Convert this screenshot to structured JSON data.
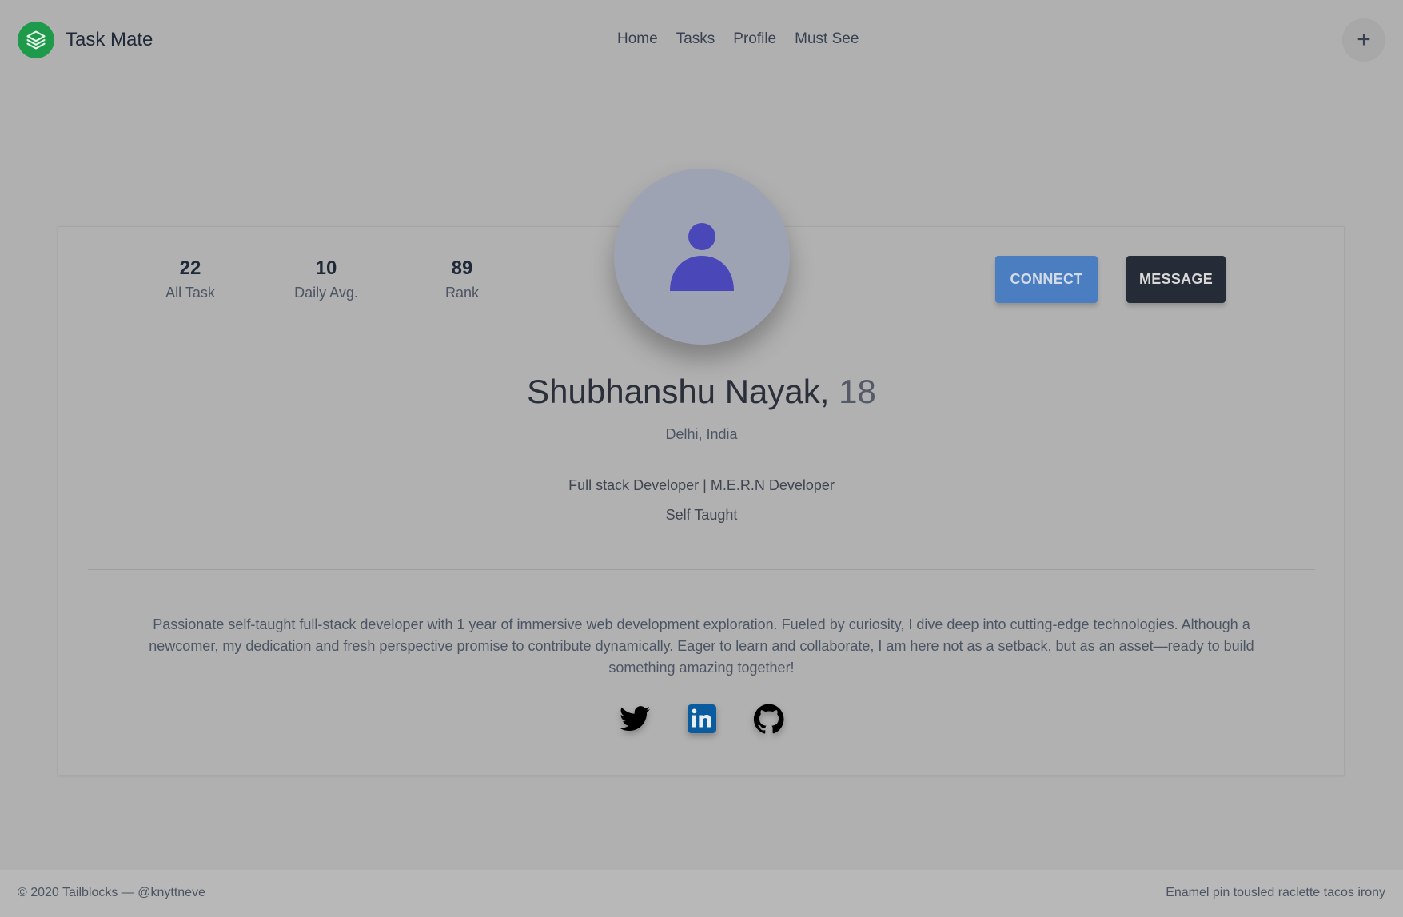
{
  "app": {
    "name": "Task Mate",
    "brand_color": "#1f9a4a"
  },
  "nav": {
    "items": [
      "Home",
      "Tasks",
      "Profile",
      "Must See"
    ]
  },
  "header": {
    "action_icon": "plus-icon",
    "action_symbol": "+"
  },
  "profile": {
    "stats": [
      {
        "value": "22",
        "label": "All Task"
      },
      {
        "value": "10",
        "label": "Daily Avg."
      },
      {
        "value": "89",
        "label": "Rank"
      }
    ],
    "avatar_icon": "user-icon",
    "avatar_color": "#4a47b8",
    "connect_label": "CONNECT",
    "message_label": "MESSAGE",
    "name": "Shubhanshu Nayak,",
    "age": "18",
    "location": "Delhi, India",
    "role": "Full stack Developer | M.E.R.N Developer",
    "tagline": "Self Taught",
    "bio": "Passionate self-taught full-stack developer with 1 year of immersive web development exploration. Fueled by curiosity, I dive deep into cutting-edge technologies. Although a newcomer, my dedication and fresh perspective promise to contribute dynamically. Eager to learn and collaborate, I am here not as a setback, but as an asset—ready to build something amazing together!",
    "socials": [
      "twitter-icon",
      "linkedin-icon",
      "github-icon"
    ]
  },
  "footer": {
    "left": "© 2020 Tailblocks — @knyttneve",
    "right": "Enamel pin tousled raclette tacos irony"
  }
}
